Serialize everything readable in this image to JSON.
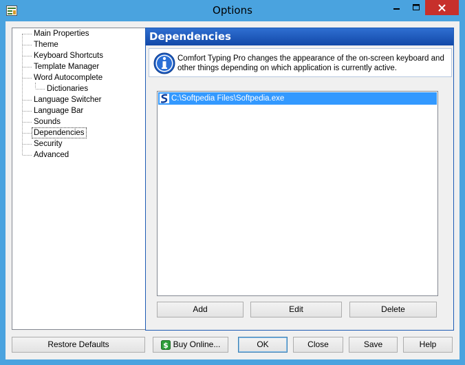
{
  "window": {
    "title": "Options",
    "icons": {
      "app": "options-app-icon",
      "minimize": "minimize-icon",
      "maximize": "maximize-icon",
      "close": "close-icon"
    }
  },
  "tree": {
    "items": [
      {
        "label": "Main Properties"
      },
      {
        "label": "Theme"
      },
      {
        "label": "Keyboard Shortcuts"
      },
      {
        "label": "Template Manager"
      },
      {
        "label": "Word Autocomplete"
      },
      {
        "label": "Dictionaries"
      },
      {
        "label": "Language Switcher"
      },
      {
        "label": "Language Bar"
      },
      {
        "label": "Sounds"
      },
      {
        "label": "Dependencies"
      },
      {
        "label": "Security"
      },
      {
        "label": "Advanced"
      }
    ],
    "selected": "Dependencies"
  },
  "panel": {
    "header": "Dependencies",
    "info_text": "Comfort Typing Pro changes the appearance of the on-screen keyboard and other things depending on which application is currently active.",
    "info_icon": "info-icon",
    "list": [
      {
        "path": "C:\\Softpedia Files\\Softpedia.exe",
        "icon": "softpedia-app-icon"
      }
    ],
    "buttons": {
      "add": "Add",
      "edit": "Edit",
      "delete": "Delete"
    }
  },
  "footer": {
    "restore_defaults": "Restore Defaults",
    "buy_online": "Buy Online...",
    "ok": "OK",
    "close": "Close",
    "save": "Save",
    "help": "Help"
  },
  "colors": {
    "titlebar": "#4aa3df",
    "close_button": "#c7302b",
    "panel_header": "#1c5ab4",
    "selection": "#3399ff"
  }
}
